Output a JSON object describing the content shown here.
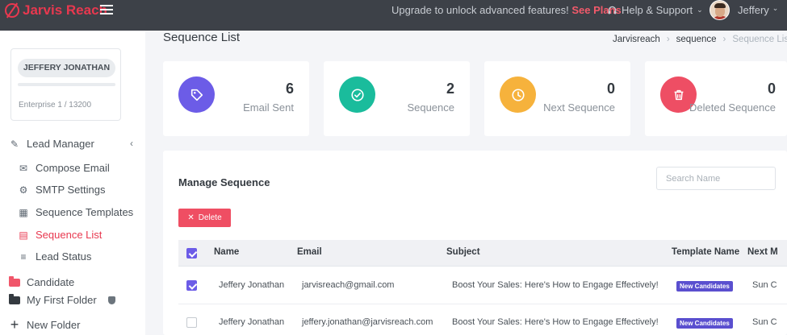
{
  "app": {
    "logo_text": "Jarvis Reach"
  },
  "topbar": {
    "upgrade_text": "Upgrade to unlock advanced features!",
    "upgrade_link": "See Plans",
    "help_label": "Help & Support",
    "user_name": "Jeffery"
  },
  "sidebar": {
    "profile_name": "JEFFERY JONATHAN",
    "plan": "Enterprise 1 / 13200",
    "lead_manager": "Lead Manager",
    "items": [
      {
        "label": "Compose Email",
        "icon": "envelope-icon"
      },
      {
        "label": "SMTP Settings",
        "icon": "gear-icon"
      },
      {
        "label": "Sequence Templates",
        "icon": "sitemap-icon"
      },
      {
        "label": "Sequence List",
        "icon": "list-icon",
        "active": true
      },
      {
        "label": "Lead Status",
        "icon": "checklist-icon"
      }
    ],
    "folders": [
      {
        "label": "Candidate",
        "color": "#f0566a"
      },
      {
        "label": "My First Folder",
        "color": "#343a40"
      }
    ],
    "new_folder": "New Folder"
  },
  "page": {
    "title": "Sequence List",
    "breadcrumb": [
      "Jarvisreach",
      "sequence",
      "Sequence List"
    ]
  },
  "stats": [
    {
      "value": "6",
      "label": "Email Sent",
      "color": "#6c5ce7",
      "icon": "tag-icon"
    },
    {
      "value": "2",
      "label": "Sequence",
      "color": "#1abc9c",
      "icon": "check-circle-icon"
    },
    {
      "value": "0",
      "label": "Next Sequence",
      "color": "#f6b23c",
      "icon": "clock-icon"
    },
    {
      "value": "0",
      "label": "Deleted Sequence",
      "color": "#ee4e64",
      "icon": "trash-icon"
    }
  ],
  "panel": {
    "title": "Manage Sequence",
    "search_placeholder": "Search Name",
    "delete_label": "Delete",
    "columns": [
      "Name",
      "Email",
      "Subject",
      "Template Name",
      "Next M"
    ],
    "rows": [
      {
        "checked": true,
        "name": "Jeffery Jonathan",
        "email": "jarvisreach@gmail.com",
        "subject": "Boost Your Sales: Here's How to Engage Effectively!",
        "template": "New Candidates",
        "next": "Sun C"
      },
      {
        "checked": false,
        "name": "Jeffery Jonathan",
        "email": "jeffery.jonathan@jarvisreach.com",
        "subject": "Boost Your Sales: Here's How to Engage Effectively!",
        "template": "New Candidates",
        "next": "Sun C"
      }
    ]
  }
}
